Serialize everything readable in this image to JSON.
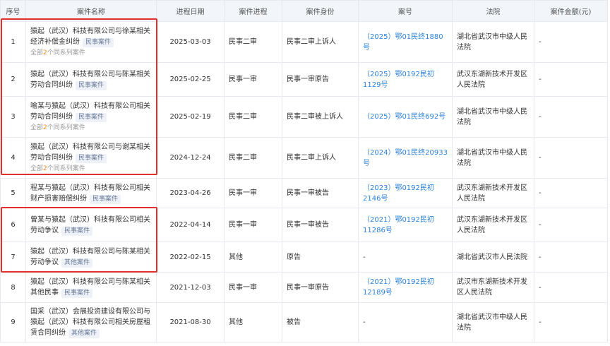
{
  "headers": [
    "序号",
    "案件名称",
    "进程日期",
    "案件进程",
    "案件身份",
    "案号",
    "法院",
    "案件金额(元)"
  ],
  "rows": [
    {
      "no": "1",
      "name": "猿起（武汉）科技有限公司与徐某相关经济补偿金纠纷",
      "tag": "民事案件",
      "sub_pre": "全部",
      "sub_num": "2",
      "sub_post": "个同系列案件",
      "date": "2025-03-03",
      "stage": "民事二审",
      "role": "民事二审上诉人",
      "caseno": "（2025）鄂01民终1880号",
      "court": "湖北省武汉市中级人民法院",
      "amount": "-"
    },
    {
      "no": "2",
      "name": "猿起（武汉）科技有限公司与陈某相关劳动合同纠纷",
      "tag": "民事案件",
      "sub_pre": "",
      "sub_num": "",
      "sub_post": "",
      "date": "2025-02-25",
      "stage": "民事一审",
      "role": "民事一审原告",
      "caseno": "（2025）鄂0192民初1129号",
      "court": "武汉东湖新技术开发区人民法院",
      "amount": "-"
    },
    {
      "no": "3",
      "name": "喻某与猿起（武汉）科技有限公司相关劳动合同纠纷",
      "tag": "民事案件",
      "sub_pre": "全部",
      "sub_num": "2",
      "sub_post": "个同系列案件",
      "date": "2025-02-19",
      "stage": "民事二审",
      "role": "民事二审被上诉人",
      "caseno": "（2025）鄂01民终692号",
      "court": "湖北省武汉市中级人民法院",
      "amount": "-"
    },
    {
      "no": "4",
      "name": "猿起（武汉）科技有限公司与谢某相关劳动合同纠纷",
      "tag": "民事案件",
      "sub_pre": "全部",
      "sub_num": "2",
      "sub_post": "个同系列案件",
      "date": "2024-12-24",
      "stage": "民事二审",
      "role": "民事二审上诉人",
      "caseno": "（2024）鄂01民终20933号",
      "court": "湖北省武汉市中级人民法院",
      "amount": "-"
    },
    {
      "no": "5",
      "name": "程某与猿起（武汉）科技有限公司相关财产损害赔偿纠纷",
      "tag": "民事案件",
      "sub_pre": "",
      "sub_num": "",
      "sub_post": "",
      "date": "2023-04-26",
      "stage": "民事一审",
      "role": "民事一审被告",
      "caseno": "（2023）鄂0192民初2146号",
      "court": "武汉东湖新技术开发区人民法院",
      "amount": "-"
    },
    {
      "no": "6",
      "name": "曾某与猿起（武汉）科技有限公司相关劳动争议",
      "tag": "民事案件",
      "sub_pre": "",
      "sub_num": "",
      "sub_post": "",
      "date": "2022-04-14",
      "stage": "民事一审",
      "role": "民事一审被告",
      "caseno": "（2021）鄂0192民初11286号",
      "court": "武汉东湖新技术开发区人民法院",
      "amount": "-"
    },
    {
      "no": "7",
      "name": "猿起（武汉）科技有限公司与陈某相关劳动争议",
      "tag": "其他案件",
      "sub_pre": "",
      "sub_num": "",
      "sub_post": "",
      "date": "2022-02-15",
      "stage": "其他",
      "role": "原告",
      "caseno": "-",
      "court": "湖北省武汉市人民法院",
      "amount": "-"
    },
    {
      "no": "8",
      "name": "猿起（武汉）科技有限公司与陈某相关其他民事",
      "tag": "民事案件",
      "sub_pre": "",
      "sub_num": "",
      "sub_post": "",
      "date": "2021-12-03",
      "stage": "民事一审",
      "role": "民事一审原告",
      "caseno": "（2021）鄂0192民初12189号",
      "court": "武汉市东湖新技术开发区人民法院",
      "amount": "-"
    },
    {
      "no": "9",
      "name": "国采（武汉）会展投资建设有限公司与猿起（武汉）科技有限公司相关房屋租赁合同纠纷",
      "tag": "其他案件",
      "sub_pre": "",
      "sub_num": "",
      "sub_post": "",
      "date": "2021-08-30",
      "stage": "其他",
      "role": "被告",
      "caseno": "-",
      "court": "湖北省武汉市中级人民法院",
      "amount": "-"
    }
  ],
  "colors": {
    "link": "#2b82d9",
    "highlight": "#e0302c",
    "count": "#f08c1a"
  }
}
